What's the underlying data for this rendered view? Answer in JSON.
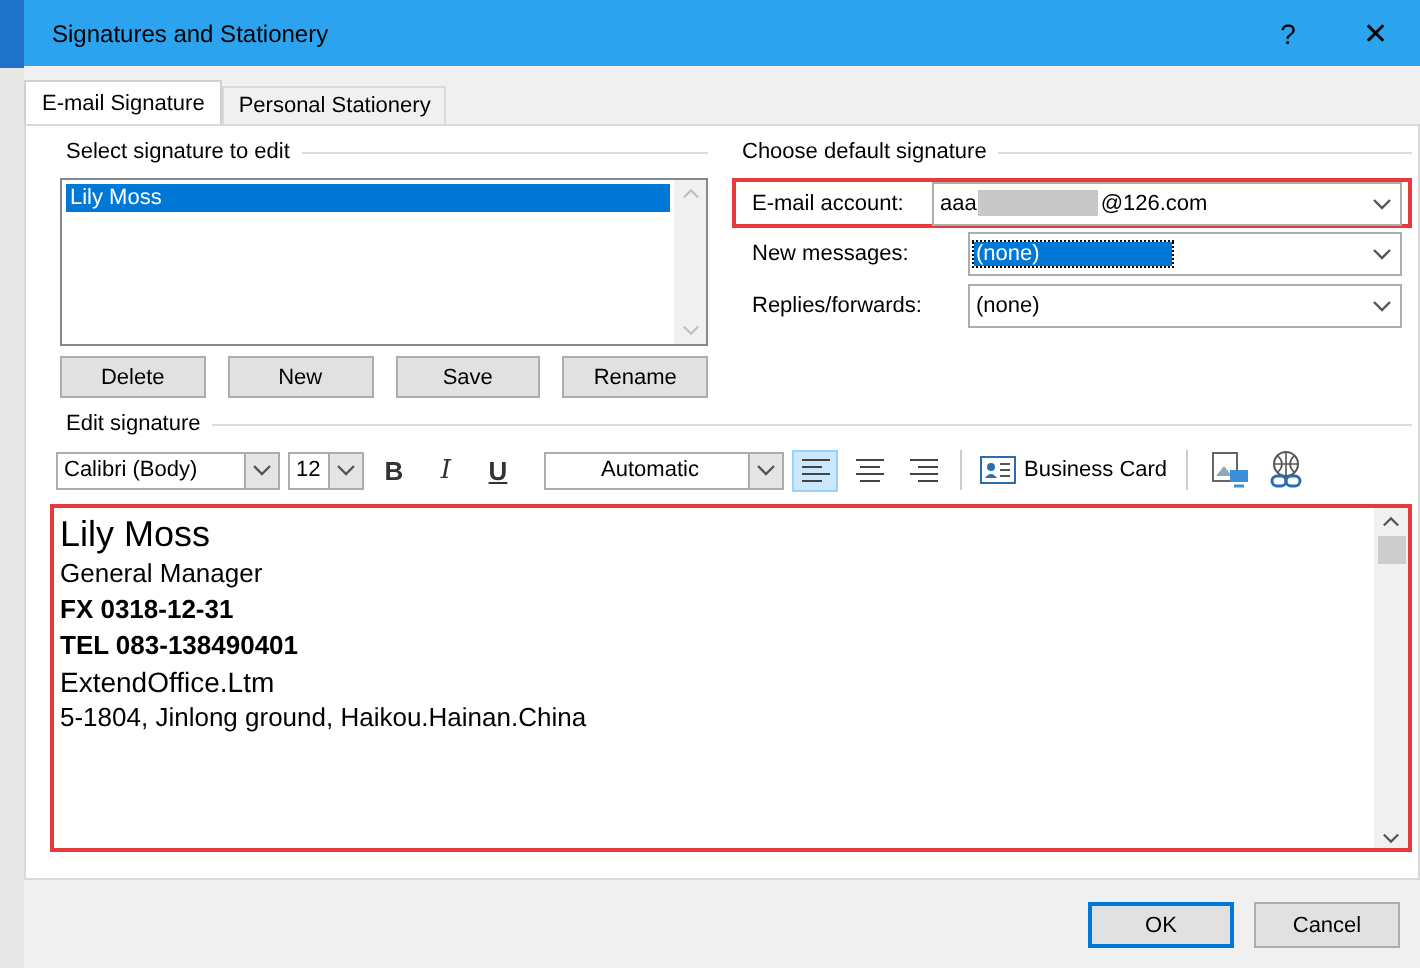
{
  "window": {
    "title": "Signatures and Stationery",
    "help": "?",
    "close": "✕"
  },
  "tabs": [
    {
      "label": "E-mail Signature",
      "selected": true
    },
    {
      "label": "Personal Stationery",
      "selected": false
    }
  ],
  "select_signature": {
    "label": "Select signature to edit",
    "items": [
      {
        "label": "Lily Moss",
        "selected": true
      }
    ],
    "buttons": [
      "Delete",
      "New",
      "Save",
      "Rename"
    ]
  },
  "default_signature": {
    "label": "Choose default signature",
    "fields": [
      {
        "label": "E-mail account:",
        "value_start": "aaa",
        "value_end": "@126.com",
        "redacted": true,
        "highlighted": true,
        "focused": false
      },
      {
        "label": "New messages:",
        "value_start": "(none)",
        "redacted": false,
        "highlighted": false,
        "focused": true
      },
      {
        "label": "Replies/forwards:",
        "value_start": "(none)",
        "redacted": false,
        "highlighted": false,
        "focused": false
      }
    ]
  },
  "edit_signature": {
    "label": "Edit signature",
    "font": "Calibri (Body)",
    "size": "12",
    "font_color_label": "Automatic",
    "format": [
      {
        "label": "B",
        "kind": "bold"
      },
      {
        "label": "I",
        "kind": "italic"
      },
      {
        "label": "U",
        "kind": "underline"
      }
    ],
    "align": [
      {
        "kind": "left",
        "selected": true
      },
      {
        "kind": "center",
        "selected": false
      },
      {
        "kind": "right",
        "selected": false
      }
    ],
    "business_card": "Business Card",
    "highlighted": true,
    "lines": [
      {
        "text": "Lily Moss",
        "kind": "name"
      },
      {
        "text": "General Manager",
        "kind": "normal"
      },
      {
        "text": "FX 0318-12-31",
        "kind": "bold"
      },
      {
        "text": "TEL 083-138490401",
        "kind": "bold"
      },
      {
        "text": "ExtendOffice.Ltm",
        "kind": "large"
      },
      {
        "text": "5-1804, Jinlong ground, Haikou.Hainan.China",
        "kind": "normal"
      }
    ]
  },
  "buttons": [
    {
      "label": "OK",
      "default": true
    },
    {
      "label": "Cancel",
      "default": false
    }
  ]
}
